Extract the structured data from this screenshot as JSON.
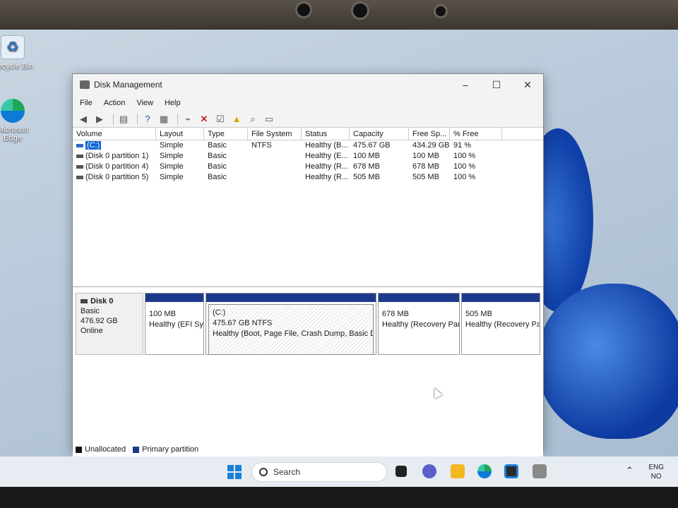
{
  "desktop": {
    "icons": [
      {
        "label": "Recycle Bin",
        "icon": "recycle-bin-icon"
      },
      {
        "label": "Microsoft Edge",
        "icon": "edge-icon"
      }
    ]
  },
  "window": {
    "title": "Disk Management",
    "controls": {
      "minimize": "–",
      "maximize": "☐",
      "close": "✕"
    },
    "menu": [
      "File",
      "Action",
      "View",
      "Help"
    ],
    "toolbar": [
      "back-icon",
      "forward-icon",
      "console-tree-icon",
      "help-icon",
      "properties-icon",
      "connect-icon",
      "delete-icon",
      "check-icon",
      "import-icon",
      "search-icon",
      "list-icon"
    ]
  },
  "volumes": {
    "columns": [
      "Volume",
      "Layout",
      "Type",
      "File System",
      "Status",
      "Capacity",
      "Free Sp...",
      "% Free"
    ],
    "rows": [
      {
        "volume": "(C:)",
        "layout": "Simple",
        "type": "Basic",
        "fs": "NTFS",
        "status": "Healthy (B...",
        "capacity": "475.67 GB",
        "free": "434.29 GB",
        "pct": "91 %",
        "selected": true
      },
      {
        "volume": "(Disk 0 partition 1)",
        "layout": "Simple",
        "type": "Basic",
        "fs": "",
        "status": "Healthy (E...",
        "capacity": "100 MB",
        "free": "100 MB",
        "pct": "100 %"
      },
      {
        "volume": "(Disk 0 partition 4)",
        "layout": "Simple",
        "type": "Basic",
        "fs": "",
        "status": "Healthy (R...",
        "capacity": "678 MB",
        "free": "678 MB",
        "pct": "100 %"
      },
      {
        "volume": "(Disk 0 partition 5)",
        "layout": "Simple",
        "type": "Basic",
        "fs": "",
        "status": "Healthy (R...",
        "capacity": "505 MB",
        "free": "505 MB",
        "pct": "100 %"
      }
    ]
  },
  "disk": {
    "name": "Disk 0",
    "type": "Basic",
    "size": "476.92 GB",
    "state": "Online",
    "partitions": [
      {
        "line1": "100 MB",
        "line2": "Healthy (EFI Sy"
      },
      {
        "title": "(C:)",
        "line1": "475.67 GB NTFS",
        "line2": "Healthy (Boot, Page File, Crash Dump, Basic Data"
      },
      {
        "line1": "678 MB",
        "line2": "Healthy (Recovery Part"
      },
      {
        "line1": "505 MB",
        "line2": "Healthy (Recovery Par"
      }
    ]
  },
  "legend": [
    {
      "label": "Unallocated",
      "color": "#111111"
    },
    {
      "label": "Primary partition",
      "color": "#1b3a8c"
    }
  ],
  "taskbar": {
    "search_label": "Search",
    "apps": [
      "task-view-icon",
      "chat-icon",
      "file-explorer-icon",
      "edge-icon",
      "store-icon",
      "disk-management-icon"
    ],
    "tray": {
      "lang": "ENG",
      "region": "NO"
    }
  }
}
